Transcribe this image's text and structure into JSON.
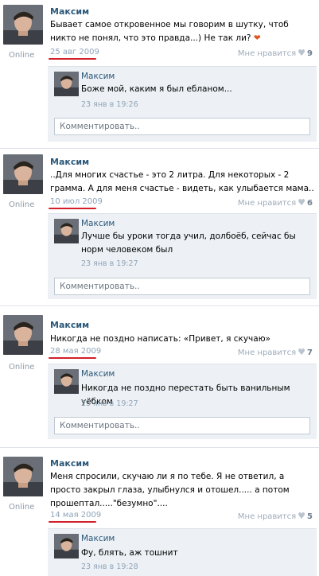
{
  "posts": [
    {
      "author": "Максим",
      "online": "Online",
      "text": "Бывает самое откровенное мы говорим в шутку, чтоб никто не понял, что это правда...) Не так ли?",
      "emoji": "❤",
      "date": "25 авг 2009",
      "like_label": "Мне нравится",
      "like_count": "9",
      "comment": {
        "author": "Максим",
        "text": "Боже мой, каким я был ебланом...",
        "date": "23 янв в 19:26",
        "input_placeholder": "Комментировать.."
      }
    },
    {
      "author": "Максим",
      "online": "Online",
      "text": "..Для многих счастье - это 2 литра. Для некоторых - 2 грамма. А для меня счастье - видеть, как улыбается мама..",
      "date": "10 июл 2009",
      "like_label": "Мне нравится",
      "like_count": "6",
      "comment": {
        "author": "Максим",
        "text": "Лучше бы уроки тогда учил, долбоёб, сейчас бы норм человеком был",
        "date": "23 янв в 19:27",
        "input_placeholder": "Комментировать.."
      }
    },
    {
      "author": "Максим",
      "online": "Online",
      "text": "Никогда не поздно написать: «Привет, я скучаю»",
      "date": "28 мая 2009",
      "like_label": "Мне нравится",
      "like_count": "7",
      "comment": {
        "author": "Максим",
        "text": "Никогда не поздно перестать быть ванильным уёбком",
        "date": "23 янв в 19:27",
        "input_placeholder": "Комментировать.."
      }
    },
    {
      "author": "Максим",
      "online": "Online",
      "text": "Меня спросили, скучаю ли я по тебе. Я не ответил, а просто закрыл глаза, улыбнулся и отошел..... а потом прошептал.....\"безумно\"....",
      "date": "14 мая 2009",
      "like_label": "Мне нравится",
      "like_count": "5",
      "comment": {
        "author": "Максим",
        "text": "Фу, блять, аж тошнит",
        "date": "23 янв в 19:28"
      }
    }
  ],
  "colors": {
    "author": "#2b587a",
    "date": "#8fa4b8",
    "underline": "#d21f2a",
    "comment_bg": "#edf1f5"
  }
}
